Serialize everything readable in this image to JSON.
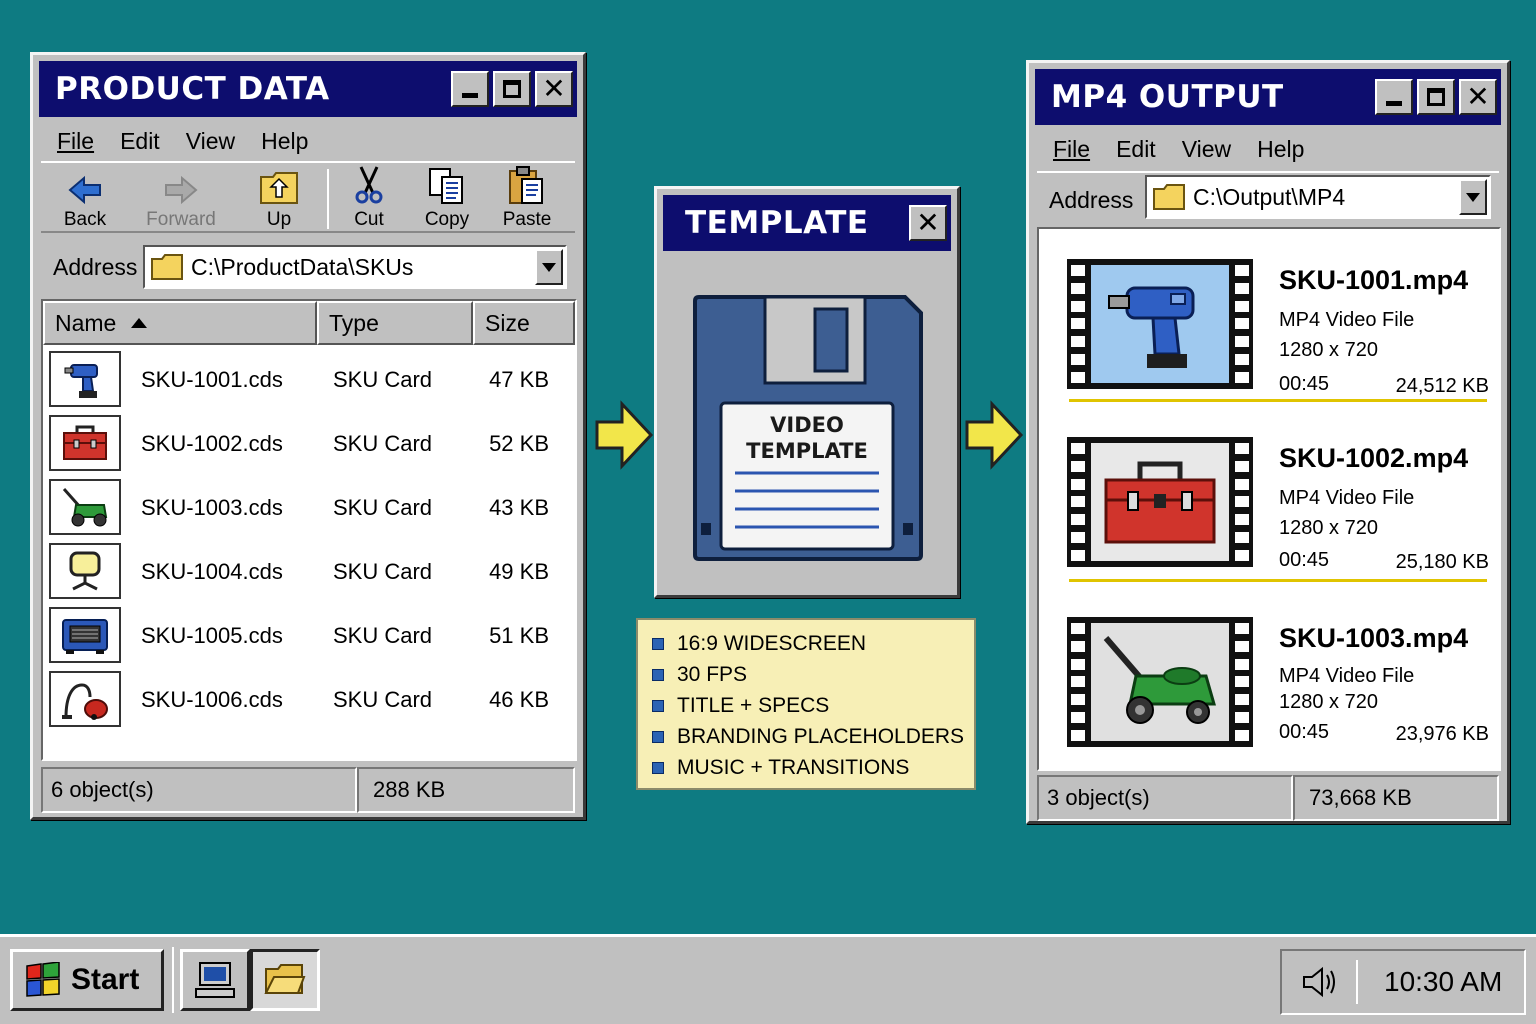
{
  "product_window": {
    "title": "PRODUCT DATA",
    "menu": [
      "File",
      "Edit",
      "View",
      "Help"
    ],
    "toolbar": [
      {
        "label": "Back",
        "icon": "back-arrow-icon"
      },
      {
        "label": "Forward",
        "icon": "forward-arrow-icon"
      },
      {
        "label": "Up",
        "icon": "up-folder-icon"
      },
      {
        "label": "Cut",
        "icon": "scissors-icon"
      },
      {
        "label": "Copy",
        "icon": "copy-icon"
      },
      {
        "label": "Paste",
        "icon": "paste-icon"
      }
    ],
    "address_label": "Address",
    "address": "C:\\ProductData\\SKUs",
    "columns": [
      "Name",
      "Type",
      "Size"
    ],
    "files": [
      {
        "name": "SKU-1001.cds",
        "type": "SKU Card",
        "size": "47 KB",
        "icon": "drill-icon"
      },
      {
        "name": "SKU-1002.cds",
        "type": "SKU Card",
        "size": "52 KB",
        "icon": "toolbox-icon"
      },
      {
        "name": "SKU-1003.cds",
        "type": "SKU Card",
        "size": "43 KB",
        "icon": "lawnmower-icon"
      },
      {
        "name": "SKU-1004.cds",
        "type": "SKU Card",
        "size": "49 KB",
        "icon": "work-light-icon"
      },
      {
        "name": "SKU-1005.cds",
        "type": "SKU Card",
        "size": "51 KB",
        "icon": "generator-icon"
      },
      {
        "name": "SKU-1006.cds",
        "type": "SKU Card",
        "size": "46 KB",
        "icon": "vacuum-icon"
      }
    ],
    "status_count": "6 object(s)",
    "status_size": "288 KB"
  },
  "template_window": {
    "title": "TEMPLATE",
    "disk_label_line1": "VIDEO",
    "disk_label_line2": "TEMPLATE",
    "features": [
      "16:9 WIDESCREEN",
      "30 FPS",
      "TITLE + SPECS",
      "BRANDING PLACEHOLDERS",
      "MUSIC + TRANSITIONS"
    ]
  },
  "output_window": {
    "title": "MP4 OUTPUT",
    "menu": [
      "File",
      "Edit",
      "View",
      "Help"
    ],
    "address_label": "Address",
    "address": "C:\\Output\\MP4",
    "videos": [
      {
        "name": "SKU-1001.mp4",
        "type": "MP4 Video File",
        "resolution": "1280 x 720",
        "duration": "00:45",
        "size": "24,512 KB",
        "icon": "drill-icon"
      },
      {
        "name": "SKU-1002.mp4",
        "type": "MP4 Video File",
        "resolution": "1280 x 720",
        "duration": "00:45",
        "size": "25,180 KB",
        "icon": "toolbox-icon"
      },
      {
        "name": "SKU-1003.mp4",
        "type": "MP4 Video File",
        "resolution": "1280 x 720",
        "duration": "00:45",
        "size": "23,976 KB",
        "icon": "lawnmower-icon"
      }
    ],
    "status_count": "3 object(s)",
    "status_size": "73,668 KB"
  },
  "taskbar": {
    "start_label": "Start",
    "clock": "10:30 AM"
  },
  "colors": {
    "desktop": "#0e7b82",
    "titlebar": "#0d0d6e",
    "window": "#c0c0c0",
    "note": "#f7efb6",
    "arrow": "#f2e64a",
    "divider": "#e0c400"
  }
}
